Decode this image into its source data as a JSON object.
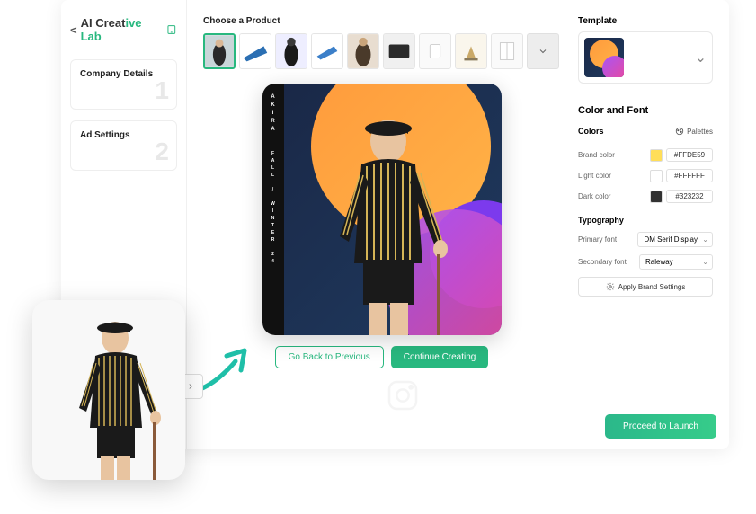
{
  "brand": {
    "back": "<",
    "part1": "AI ",
    "part2": "Creat",
    "part3": "ive Lab"
  },
  "sidebar": {
    "steps": [
      {
        "title": "Company Details",
        "num": "1"
      },
      {
        "title": "Ad Settings",
        "num": "2"
      }
    ]
  },
  "center": {
    "choose_label": "Choose a Product",
    "preview": {
      "brandline": "AKIRA",
      "tagline": "FALL / WINTER 24"
    },
    "buttons": {
      "back": "Go Back to Previous",
      "continue": "Continue Creating"
    }
  },
  "right": {
    "template_label": "Template",
    "cf_title": "Color and Font",
    "colors_label": "Colors",
    "palettes_label": "Palettes",
    "colors": [
      {
        "label": "Brand color",
        "value": "#FFDE59",
        "swatch": "#FFDE59"
      },
      {
        "label": "Light color",
        "value": "#FFFFFF",
        "swatch": "#FFFFFF"
      },
      {
        "label": "Dark color",
        "value": "#323232",
        "swatch": "#323232"
      }
    ],
    "typo_label": "Typography",
    "fonts": [
      {
        "label": "Primary font",
        "value": "DM Serif Display"
      },
      {
        "label": "Secondary font",
        "value": "Raleway"
      }
    ],
    "apply_label": "Apply Brand Settings",
    "proceed_label": "Proceed to Launch"
  }
}
